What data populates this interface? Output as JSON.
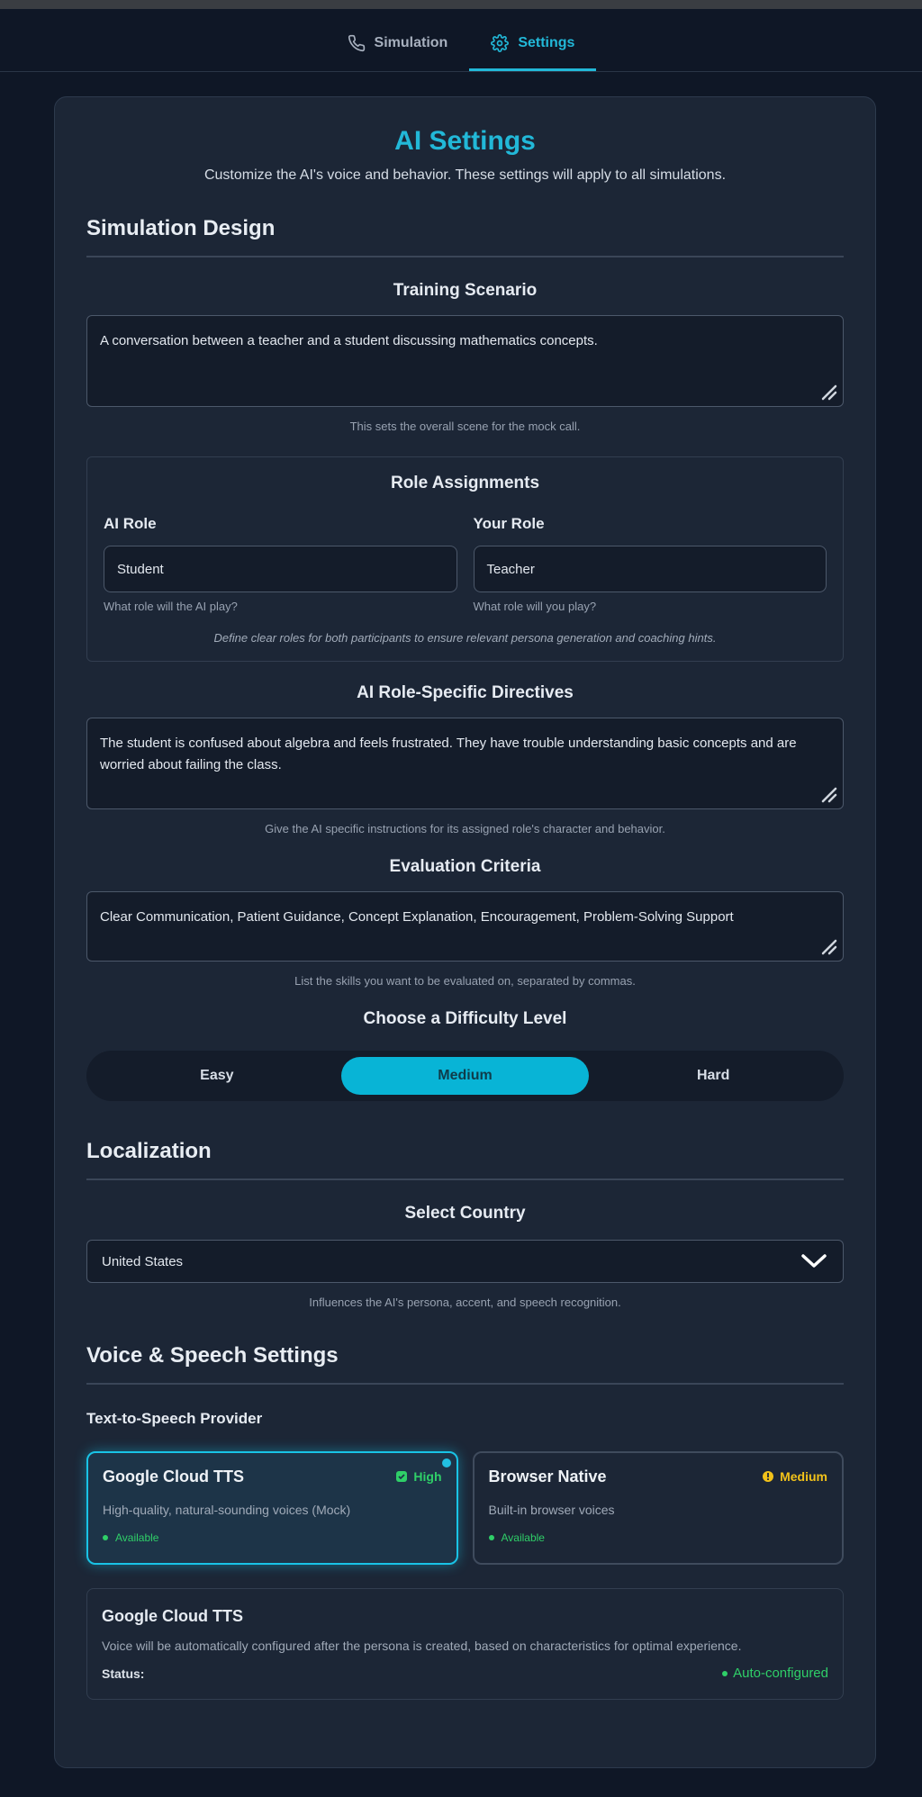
{
  "tabs": [
    {
      "label": "Simulation",
      "icon": "phone-icon",
      "active": false
    },
    {
      "label": "Settings",
      "icon": "gear-icon",
      "active": true
    }
  ],
  "header": {
    "title": "AI Settings",
    "subtitle": "Customize the AI's voice and behavior. These settings will apply to all simulations."
  },
  "simulation_design": {
    "heading": "Simulation Design",
    "training_scenario": {
      "label": "Training Scenario",
      "value": "A conversation between a teacher and a student discussing mathematics concepts.",
      "helper": "This sets the overall scene for the mock call."
    },
    "roles": {
      "heading": "Role Assignments",
      "ai_role_label": "AI Role",
      "ai_role_value": "Student",
      "ai_role_help": "What role will the AI play?",
      "your_role_label": "Your Role",
      "your_role_value": "Teacher",
      "your_role_help": "What role will you play?",
      "note": "Define clear roles for both participants to ensure relevant persona generation and coaching hints."
    },
    "directives": {
      "label": "AI Role-Specific Directives",
      "value": "The student is confused about algebra and feels frustrated. They have trouble understanding basic concepts and are worried about failing the class.",
      "helper": "Give the AI specific instructions for its assigned role's character and behavior."
    },
    "criteria": {
      "label": "Evaluation Criteria",
      "value": "Clear Communication, Patient Guidance, Concept Explanation, Encouragement, Problem-Solving Support",
      "helper": "List the skills you want to be evaluated on, separated by commas."
    },
    "difficulty": {
      "label": "Choose a Difficulty Level",
      "options": [
        "Easy",
        "Medium",
        "Hard"
      ],
      "selected": "Medium"
    }
  },
  "localization": {
    "heading": "Localization",
    "country_label": "Select Country",
    "country_value": "United States",
    "helper": "Influences the AI's persona, accent, and speech recognition."
  },
  "voice": {
    "heading": "Voice & Speech Settings",
    "provider_label": "Text-to-Speech Provider",
    "providers": [
      {
        "name": "Google Cloud TTS",
        "quality": "High",
        "description": "High-quality, natural-sounding voices (Mock)",
        "status": "Available",
        "selected": true
      },
      {
        "name": "Browser Native",
        "quality": "Medium",
        "description": "Built-in browser voices",
        "status": "Available",
        "selected": false
      }
    ],
    "info": {
      "title": "Google Cloud TTS",
      "description": "Voice will be automatically configured after the persona is created, based on characteristics for optimal experience.",
      "status_label": "Status:",
      "status_value": "Auto-configured"
    }
  },
  "colors": {
    "accent": "#22b8d8",
    "background": "#0f1726",
    "card": "#1c2636",
    "success": "#2fcf68",
    "warning": "#f2c21a"
  }
}
